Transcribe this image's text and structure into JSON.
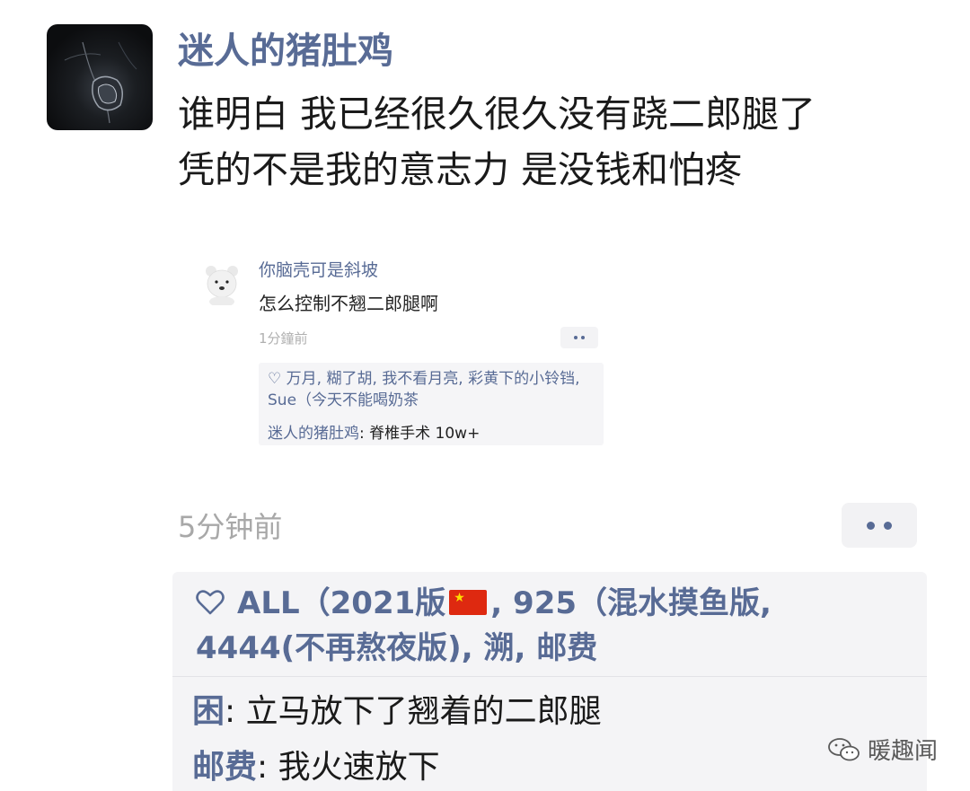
{
  "post": {
    "username": "迷人的猪肚鸡",
    "text_lines": [
      "谁明白 我已经很久很久没有跷二郎腿了",
      "凭的不是我的意志力 是没钱和怕疼"
    ],
    "time": "5分钟前"
  },
  "embedded_comment": {
    "username": "你脑壳可是斜坡",
    "text": "怎么控制不翘二郎腿啊",
    "time": "1分鐘前",
    "likes": "万月, 糊了胡, 我不看月亮, 彩黄下的小铃铛, Sue（今天不能喝奶茶",
    "reply_author": "迷人的猪肚鸡",
    "reply_text": ": 脊椎手术 10w+"
  },
  "likes": {
    "line1_before_flag": "ALL（2021版",
    "line1_after_flag": ", 925（混水摸鱼版,",
    "line2": "4444(不再熬夜版), 溯, 邮费"
  },
  "replies": [
    {
      "author": "困",
      "text": ": 立马放下了翘着的二郎腿"
    },
    {
      "author": "邮费",
      "text": ": 我火速放下"
    }
  ],
  "watermark": {
    "text": "暖趣闻"
  },
  "colors": {
    "name_blue": "#586b95",
    "time_gray": "#a8a8a8",
    "box_bg": "#f4f4f6"
  },
  "icons": {
    "heart": "heart-outline-icon",
    "more": "more-dots-icon",
    "flag": "china-flag-emoji"
  }
}
